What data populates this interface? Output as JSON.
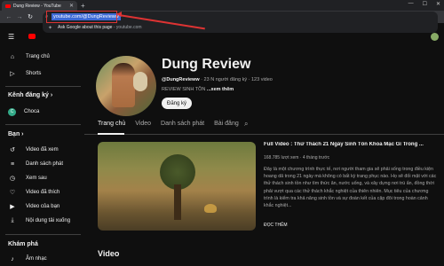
{
  "browser": {
    "tab_title": "Dung Review - YouTube",
    "url": "youtube.com/@DungRevieww",
    "suggestion_text": "Ask Google about this page",
    "suggestion_domain": "youtube.com"
  },
  "sidebar": {
    "home": "Trang chủ",
    "shorts": "Shorts",
    "subs_heading": "Kênh đăng ký",
    "sub_channel": "Choca",
    "you_heading": "Bạn",
    "items": [
      {
        "label": "Video đã xem",
        "icon": "history-icon"
      },
      {
        "label": "Danh sách phát",
        "icon": "playlist-icon"
      },
      {
        "label": "Xem sau",
        "icon": "clock-icon"
      },
      {
        "label": "Video đã thích",
        "icon": "thumbs-up-icon"
      },
      {
        "label": "Video của bạn",
        "icon": "video-icon"
      },
      {
        "label": "Nội dung tải xuống",
        "icon": "download-icon"
      }
    ],
    "explore_heading": "Khám phá",
    "music": "Âm nhạc"
  },
  "channel": {
    "name": "Dung Review",
    "handle": "@DungRevieww",
    "meta": " · 23 N người đăng ký · 123 video",
    "desc": "REVIEW SINH TỒN",
    "more": " ...xem thêm",
    "subscribe": "Đăng ký"
  },
  "tabs": [
    "Trang chủ",
    "Video",
    "Danh sách phát",
    "Bài đăng"
  ],
  "featured": {
    "title": "Full Video : Thử Thách 21 Ngày Sinh Tồn Khỏa Mặc Gì Trong ...",
    "stats": "168.785 lượt xem · 4 tháng trước",
    "description": "Đây là một chương trình thực tế, nơi người tham gia sẽ phải sống trong điều kiện hoang dã trong 21 ngày mà không có bất kỳ trang phục nào. Họ sẽ đối mặt với các thử thách sinh tồn như tìm thức ăn, nước uống, và xây dựng nơi trú ẩn, đồng thời phải vượt qua các thử thách khắc nghiệt của thiên nhiên. Mục tiêu của chương trình là kiểm tra khả năng sinh tồn và sự đoàn kết của cặp đôi trong hoàn cảnh khắc nghiệt...",
    "read_more": "ĐỌC THÊM"
  },
  "section_title": "Video"
}
